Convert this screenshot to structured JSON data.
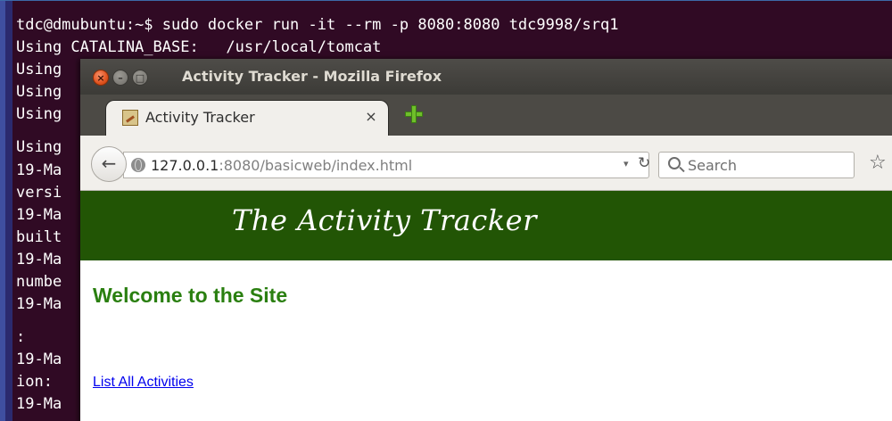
{
  "terminal": {
    "lines": [
      "tdc@dmubuntu:~$ sudo docker run -it --rm -p 8080:8080 tdc9998/srq1",
      "Using CATALINA_BASE:   /usr/local/tomcat",
      "Using",
      "Using",
      "Using",
      "Using",
      "19-Ma",
      "versi",
      "19-Ma",
      "built",
      "19-Ma",
      "numbe",
      "19-Ma",
      ":",
      "19-Ma",
      "ion:",
      "19-Ma"
    ]
  },
  "browser": {
    "window_title": "Activity Tracker - Mozilla Firefox",
    "window_buttons": {
      "close": "×",
      "minimize": "–",
      "maximize": "□"
    },
    "tab": {
      "label": "Activity Tracker",
      "close": "×"
    },
    "url": {
      "host": "127.0.0.1",
      "rest": ":8080/basicweb/index.html"
    },
    "url_dropdown": "▾",
    "reload": "↻",
    "back": "←",
    "search": {
      "placeholder": "Search"
    },
    "bookmark": "☆"
  },
  "page": {
    "header_title": "The Activity Tracker",
    "welcome": "Welcome to the Site",
    "link": "List All Activities"
  },
  "colors": {
    "terminal_bg": "#300a24",
    "header_green": "#225505",
    "welcome_green": "#2a7f10",
    "link_blue": "#0000ee"
  }
}
